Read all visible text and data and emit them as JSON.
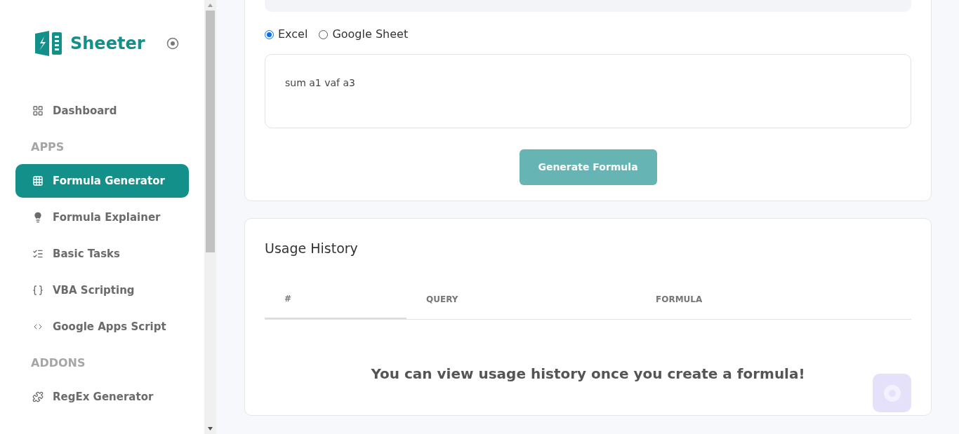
{
  "brand": {
    "name": "Sheeter"
  },
  "sidebar": [
    {
      "kind": "item",
      "label": "Dashboard",
      "selected": false
    },
    {
      "kind": "section",
      "label": "APPS"
    },
    {
      "kind": "item",
      "label": "Formula Generator",
      "selected": true
    },
    {
      "kind": "item",
      "label": "Formula Explainer",
      "selected": false
    },
    {
      "kind": "item",
      "label": "Basic Tasks",
      "selected": false
    },
    {
      "kind": "item",
      "label": "VBA Scripting",
      "selected": false
    },
    {
      "kind": "item",
      "label": "Google Apps Script",
      "selected": false
    },
    {
      "kind": "section",
      "label": "ADDONS"
    },
    {
      "kind": "item",
      "label": "RegEx Generator",
      "selected": false
    }
  ],
  "generator": {
    "platforms": [
      {
        "label": "Excel",
        "selected": true
      },
      {
        "label": "Google Sheet",
        "selected": false
      }
    ],
    "query": "sum a1 vaf a3",
    "button": "Generate Formula"
  },
  "history": {
    "title": "Usage History",
    "columns": [
      {
        "label": "#",
        "selected": true
      },
      {
        "label": "QUERY",
        "selected": false
      },
      {
        "label": "FORMULA",
        "selected": false
      }
    ],
    "empty_message": "You can view usage history once you create a formula!"
  }
}
